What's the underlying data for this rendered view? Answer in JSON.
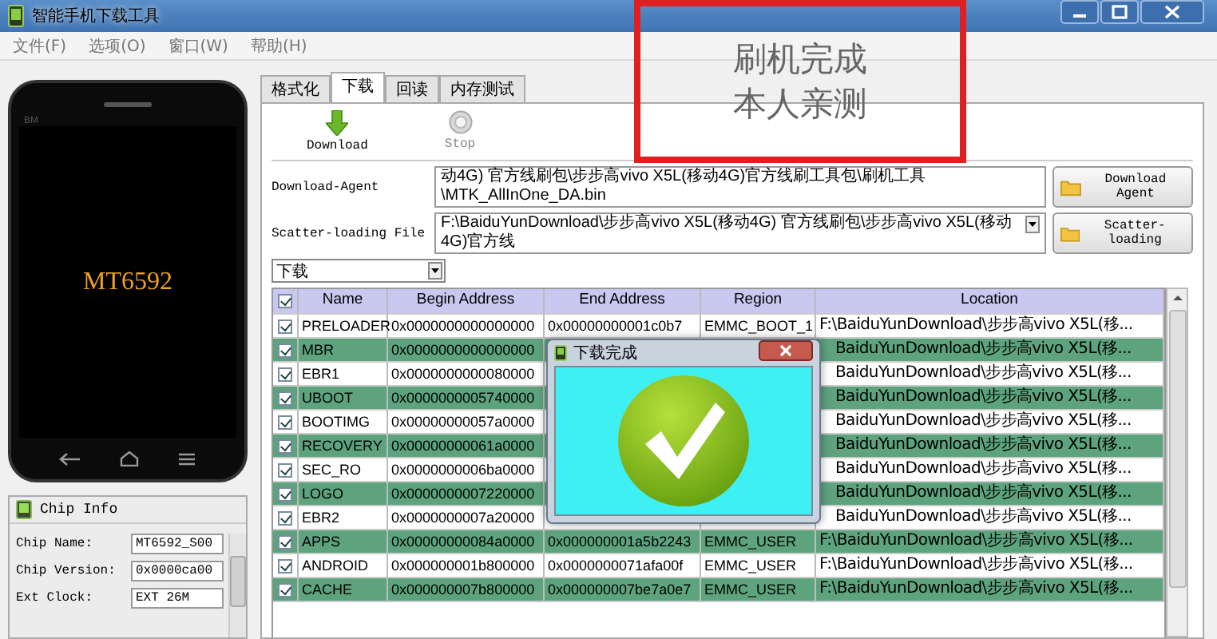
{
  "window": {
    "title": "智能手机下载工具"
  },
  "menu": [
    "文件(F)",
    "选项(O)",
    "窗口(W)",
    "帮助(H)"
  ],
  "overlay_note": {
    "lines": [
      "刷机完成",
      "本人亲测"
    ]
  },
  "phone": {
    "brand": "BM",
    "chip": "MT6592"
  },
  "chip_info": {
    "title": "Chip Info",
    "fields": [
      {
        "label": "Chip Name:",
        "value": "MT6592_S00"
      },
      {
        "label": "Chip Version:",
        "value": "0x0000ca00"
      },
      {
        "label": "Ext Clock:",
        "value": "EXT 26M"
      }
    ]
  },
  "tabs": [
    {
      "label": "格式化",
      "selected": false
    },
    {
      "label": "下载",
      "selected": true
    },
    {
      "label": "回读",
      "selected": false
    },
    {
      "label": "内存测试",
      "selected": false
    }
  ],
  "toolbar": [
    {
      "label": "Download",
      "kind": "download",
      "disabled": false
    },
    {
      "label": "Stop",
      "kind": "stop",
      "disabled": true
    }
  ],
  "download_agent": {
    "label": "Download-Agent",
    "value": "动4G) 官方线刷包\\步步高vivo X5L(移动4G)官方线刷工具包\\刷机工具\\MTK_AllInOne_DA.bin",
    "button": "Download Agent"
  },
  "scatter": {
    "label": "Scatter-loading File",
    "value": "F:\\BaiduYunDownload\\步步高vivo X5L(移动4G) 官方线刷包\\步步高vivo X5L(移动4G)官方线",
    "button": "Scatter-loading"
  },
  "mode_select": {
    "value": "下载"
  },
  "table": {
    "header_checked": true,
    "columns": [
      "Name",
      "Begin Address",
      "End Address",
      "Region",
      "Location"
    ],
    "rows": [
      {
        "name": "PRELOADER",
        "begin": "0x0000000000000000",
        "end": "0x00000000001c0b7",
        "region": "EMMC_BOOT_1",
        "location": "F:\\BaiduYunDownload\\步步高vivo X5L(移...",
        "checked": true,
        "highlighted": false
      },
      {
        "name": "MBR",
        "begin": "0x0000000000000000",
        "location": "BaiduYunDownload\\步步高vivo X5L(移...",
        "checked": true,
        "highlighted": true
      },
      {
        "name": "EBR1",
        "begin": "0x0000000000080000",
        "location": "BaiduYunDownload\\步步高vivo X5L(移...",
        "checked": true,
        "highlighted": false
      },
      {
        "name": "UBOOT",
        "begin": "0x0000000005740000",
        "location": "BaiduYunDownload\\步步高vivo X5L(移...",
        "checked": true,
        "highlighted": true
      },
      {
        "name": "BOOTIMG",
        "begin": "0x00000000057a0000",
        "location": "BaiduYunDownload\\步步高vivo X5L(移...",
        "checked": true,
        "highlighted": false
      },
      {
        "name": "RECOVERY",
        "begin": "0x00000000061a0000",
        "location": "BaiduYunDownload\\步步高vivo X5L(移...",
        "checked": true,
        "highlighted": true
      },
      {
        "name": "SEC_RO",
        "begin": "0x0000000006ba0000",
        "location": "BaiduYunDownload\\步步高vivo X5L(移...",
        "checked": true,
        "highlighted": false
      },
      {
        "name": "LOGO",
        "begin": "0x0000000007220000",
        "location": "BaiduYunDownload\\步步高vivo X5L(移...",
        "checked": true,
        "highlighted": true
      },
      {
        "name": "EBR2",
        "begin": "0x0000000007a20000",
        "location": "BaiduYunDownload\\步步高vivo X5L(移...",
        "checked": true,
        "highlighted": false
      },
      {
        "name": "APPS",
        "begin": "0x00000000084a0000",
        "end": "0x000000001a5b2243",
        "region": "EMMC_USER",
        "location": "F:\\BaiduYunDownload\\步步高vivo X5L(移...",
        "checked": true,
        "highlighted": true
      },
      {
        "name": "ANDROID",
        "begin": "0x000000001b800000",
        "end": "0x0000000071afa00f",
        "region": "EMMC_USER",
        "location": "F:\\BaiduYunDownload\\步步高vivo X5L(移...",
        "checked": true,
        "highlighted": false
      },
      {
        "name": "CACHE",
        "begin": "0x000000007b800000",
        "end": "0x000000007be7a0e7",
        "region": "EMMC_USER",
        "location": "F:\\BaiduYunDownload\\步步高vivo X5L(移...",
        "checked": true,
        "highlighted": true
      }
    ]
  },
  "dialog": {
    "title": "下载完成"
  }
}
